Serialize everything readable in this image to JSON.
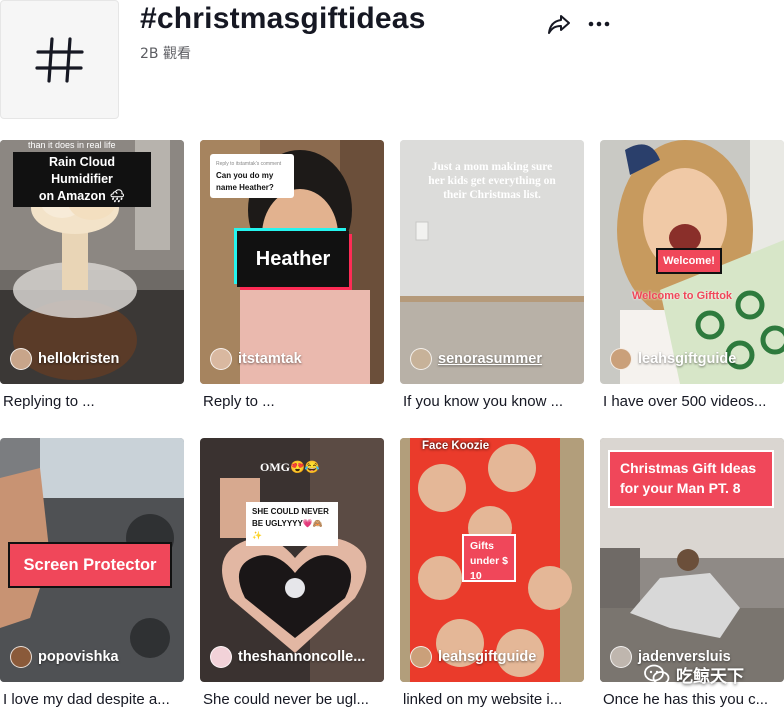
{
  "header": {
    "title": "#christmasgiftideas",
    "views": "2B 觀看",
    "avatar_icon": "hashtag-icon",
    "share_icon": "share-arrow-icon",
    "more_icon": "more-dots-icon"
  },
  "videos": [
    {
      "author": "hellokristen",
      "caption": "Replying to ...",
      "overlay_top": "than it does in real life",
      "overlay_lines": [
        "Rain Cloud Humidifier",
        "on Amazon 🌧"
      ]
    },
    {
      "author": "itstamtak",
      "caption": "Reply to ...",
      "overlay_comment_user": "Reply to itstamtak's comment",
      "overlay_comment": "Can you do my name Heather?",
      "overlay_big": "Heather"
    },
    {
      "author": "senorasummer",
      "caption": "If you know you know ...",
      "overlay_serif": "Just a mom making sure her kids get everything on their Christmas list."
    },
    {
      "author": "leahsgiftguide",
      "caption": "I have over 500 videos...",
      "overlay_badge": "Welcome!",
      "overlay_sub": "Welcome to Gifttok"
    },
    {
      "author": "popovishka",
      "caption": "I love my dad despite a...",
      "overlay_big": "Screen Protector"
    },
    {
      "author": "theshannoncolle...",
      "caption": "She could never be ugl...",
      "overlay_top": "OMG😍😂",
      "overlay_note": "SHE COULD NEVER BE UGLYYYY💗🙈✨"
    },
    {
      "author": "leahsgiftguide",
      "caption": "linked on my website i...",
      "overlay_top": "Face Koozie",
      "overlay_badge": "Gifts under $ 10"
    },
    {
      "author": "jadenversluis",
      "caption": "Once he has this you c...",
      "overlay_big": "Christmas Gift Ideas for your Man PT. 8"
    }
  ],
  "watermark": "吃鲸天下",
  "colors": {
    "accent": "#f0475a",
    "text": "#161823",
    "muted": "#5c5d62"
  }
}
